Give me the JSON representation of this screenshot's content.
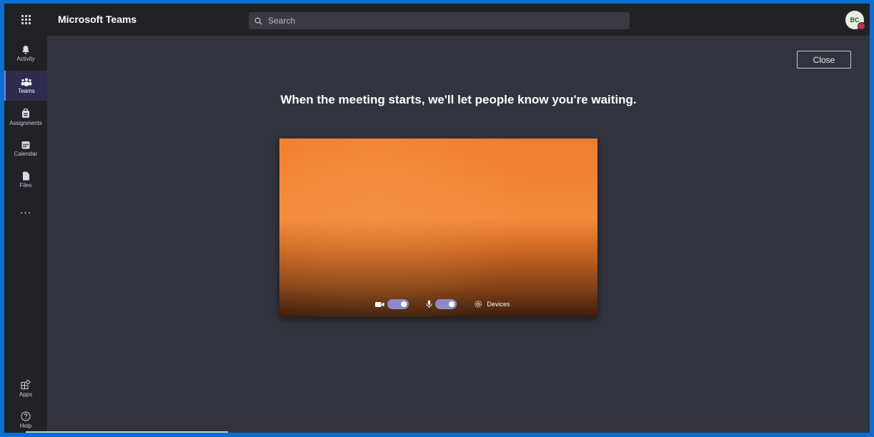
{
  "topbar": {
    "app_title": "Microsoft Teams",
    "search_placeholder": "Search",
    "avatar_initials": "BC"
  },
  "rail": {
    "items": [
      {
        "label": "Activity",
        "icon": "bell-icon"
      },
      {
        "label": "Teams",
        "icon": "teams-icon",
        "active": true
      },
      {
        "label": "Assignments",
        "icon": "assignments-icon"
      },
      {
        "label": "Calendar",
        "icon": "calendar-icon"
      },
      {
        "label": "Files",
        "icon": "files-icon"
      }
    ],
    "more": "...",
    "bottom": [
      {
        "label": "Apps",
        "icon": "apps-icon"
      },
      {
        "label": "Help",
        "icon": "help-icon"
      }
    ]
  },
  "main": {
    "close_label": "Close",
    "heading": "When the meeting starts, we'll let people know you're waiting.",
    "controls": {
      "camera_on": true,
      "mic_on": true,
      "devices_label": "Devices"
    }
  },
  "colors": {
    "accent": "#7b83eb",
    "toggle": "#8b8cc7",
    "background": "#33333d",
    "chrome": "#222226",
    "frame": "#0a6fd1"
  }
}
